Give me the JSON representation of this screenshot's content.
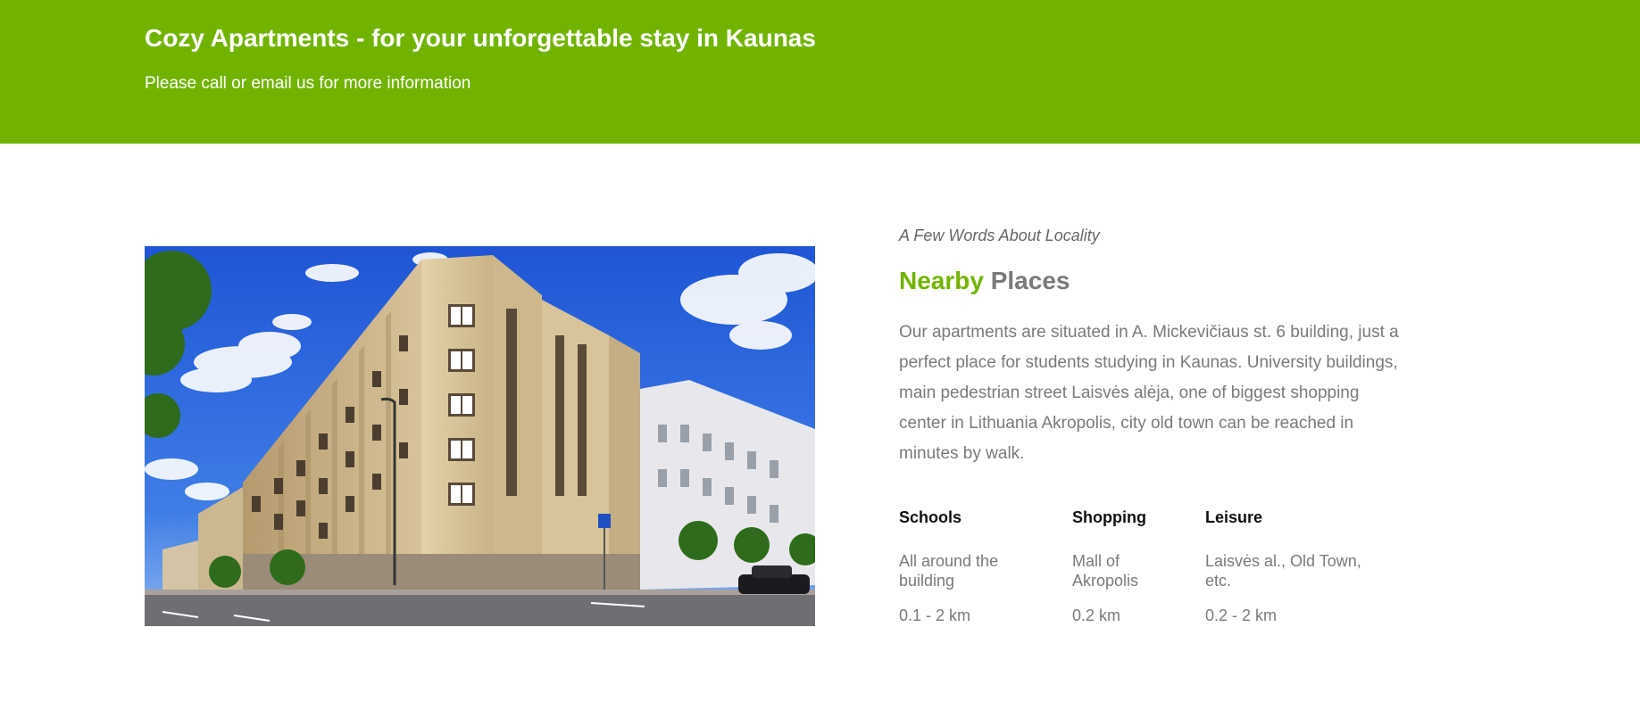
{
  "header": {
    "title": "Cozy Apartments - for your unforgettable stay in Kaunas",
    "subtitle": "Please call or email us for more information",
    "background_color": "#72b300"
  },
  "locality": {
    "eyebrow": "A Few Words About Locality",
    "title_accent": "Nearby",
    "title_rest": "Places",
    "description": "Our apartments are situated in A. Mickevičiaus st. 6 building, just a perfect place for students studying in Kaunas. University buildings, main pedestrian street Laisvės alėja, one of biggest shopping center in Lithuania Akropolis, city old town can be reached in minutes by walk.",
    "categories": [
      {
        "heading": "Schools",
        "places": "All around the building",
        "distance": "0.1 - 2 km"
      },
      {
        "heading": "Shopping",
        "places": "Mall of Akropolis",
        "distance": "0.2 km"
      },
      {
        "heading": "Leisure",
        "places": "Laisvės al., Old Town, etc.",
        "distance": "0.2 - 2 km"
      }
    ]
  },
  "photo": {
    "icon": "building-photo",
    "description_icon": "street-sign-icon"
  }
}
